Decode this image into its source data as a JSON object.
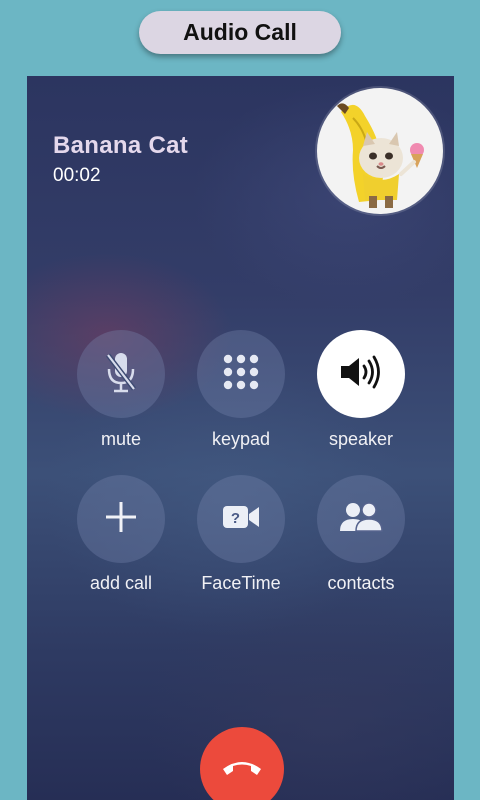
{
  "header": {
    "title": "Audio Call"
  },
  "caller": {
    "name": "Banana Cat",
    "duration": "00:02"
  },
  "controls": [
    {
      "label": "mute",
      "icon": "mic-off-icon"
    },
    {
      "label": "keypad",
      "icon": "keypad-icon"
    },
    {
      "label": "speaker",
      "icon": "speaker-icon",
      "active": true
    },
    {
      "label": "add call",
      "icon": "plus-icon"
    },
    {
      "label": "FaceTime",
      "icon": "video-camera-icon"
    },
    {
      "label": "contacts",
      "icon": "contacts-icon"
    }
  ],
  "colors": {
    "frame": "#6cb6c4",
    "header_pill": "#dcd6e3",
    "end_call": "#ec4a3c",
    "caller_name": "#e4d8ec"
  }
}
